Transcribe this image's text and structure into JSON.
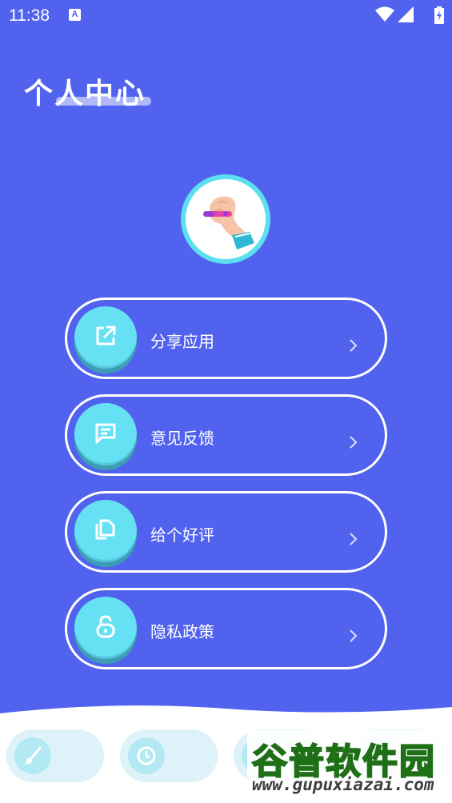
{
  "status_bar": {
    "time": "11:38",
    "app_icon_letter": "A"
  },
  "header": {
    "title": "个人中心"
  },
  "menu": [
    {
      "label": "分享应用",
      "icon": "share-icon"
    },
    {
      "label": "意见反馈",
      "icon": "message-icon"
    },
    {
      "label": "给个好评",
      "icon": "copy-icon"
    },
    {
      "label": "隐私政策",
      "icon": "lock-icon"
    }
  ],
  "bottom_nav": [
    {
      "icon": "brush-icon"
    },
    {
      "icon": "clock-icon"
    },
    {
      "icon": "circle-icon"
    },
    {
      "icon": "circle-icon"
    }
  ],
  "watermark": {
    "brand": "谷普软件园",
    "url": "www.gupuxiazai.com"
  },
  "colors": {
    "background": "#5163EE",
    "accent": "#66E1F3",
    "text": "#FFFFFF"
  }
}
